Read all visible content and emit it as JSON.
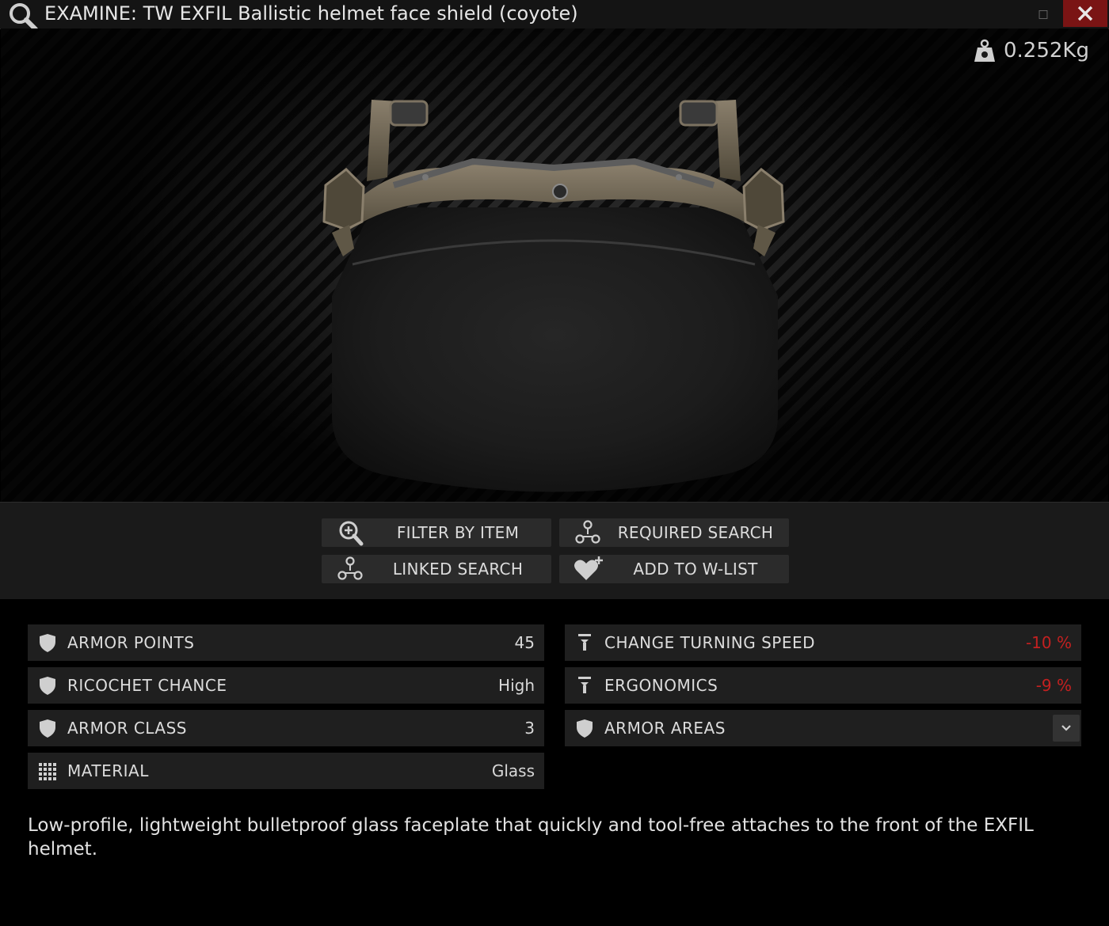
{
  "window": {
    "title": "EXAMINE: TW EXFIL Ballistic helmet face shield (coyote)",
    "minimize_glyph": "□",
    "close_icon": "close-icon"
  },
  "viewport": {
    "weight": "0.252Kg",
    "weight_icon": "weight-icon"
  },
  "actions": [
    {
      "label": "FILTER BY ITEM",
      "icon": "magnifier-plus-icon"
    },
    {
      "label": "REQUIRED SEARCH",
      "icon": "hub-nodes-icon"
    },
    {
      "label": "LINKED SEARCH",
      "icon": "hub-nodes-icon"
    },
    {
      "label": "ADD TO W-LIST",
      "icon": "heart-plus-icon"
    }
  ],
  "stats_left": [
    {
      "label": "ARMOR POINTS",
      "value": "45",
      "icon": "shield-icon"
    },
    {
      "label": "RICOCHET CHANCE",
      "value": "High",
      "icon": "shield-icon"
    },
    {
      "label": "ARMOR CLASS",
      "value": "3",
      "icon": "shield-icon"
    },
    {
      "label": "MATERIAL",
      "value": "Glass",
      "icon": "grid-dots-icon"
    }
  ],
  "stats_right": [
    {
      "label": "CHANGE TURNING SPEED",
      "value": "-10 %",
      "icon": "arrow-down-icon"
    },
    {
      "label": "ERGONOMICS",
      "value": "-9 %",
      "icon": "arrow-down-icon"
    },
    {
      "label": "ARMOR AREAS",
      "value": "",
      "icon": "shield-icon"
    }
  ],
  "colors": {
    "negative": "#c42020",
    "close_button": "#7a1414"
  },
  "description": "Low-profile, lightweight bulletproof glass faceplate that quickly and tool-free attaches to the front of the EXFIL helmet."
}
